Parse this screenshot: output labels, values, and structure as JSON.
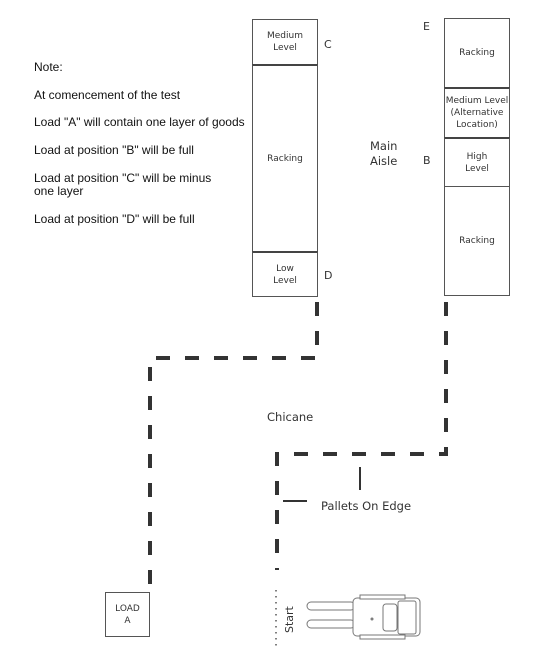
{
  "notes": {
    "heading": "Note:",
    "lines": [
      "At comencement of the test",
      "Load \"A\" will contain one layer of goods",
      "Load at position \"B\" will be full",
      "Load at position \"C\" will be minus",
      "one layer",
      "Load at position \"D\" will be full"
    ]
  },
  "left_rack": {
    "top": "Medium\nLevel",
    "top_l1": "Medium",
    "top_l2": "Level",
    "middle": "Racking",
    "bottom_l1": "Low",
    "bottom_l2": "Level",
    "marker_top": "C",
    "marker_bottom": "D"
  },
  "right_rack": {
    "marker_top": "E",
    "marker_mid": "B",
    "sections": {
      "racking_top": "Racking",
      "medium_l1": "Medium Level",
      "medium_l2": "(Alternative",
      "medium_l3": "Location)",
      "high_l1": "High",
      "high_l2": "Level",
      "racking_bottom": "Racking"
    }
  },
  "aisle": {
    "l1": "Main",
    "l2": "Aisle"
  },
  "chicane_label": "Chicane",
  "pallets_label": "Pallets On Edge",
  "load_a": {
    "l1": "LOAD",
    "l2": "A"
  },
  "start_label": "Start",
  "colors": {
    "path": "#333333",
    "border": "#555555",
    "text": "#333333"
  }
}
